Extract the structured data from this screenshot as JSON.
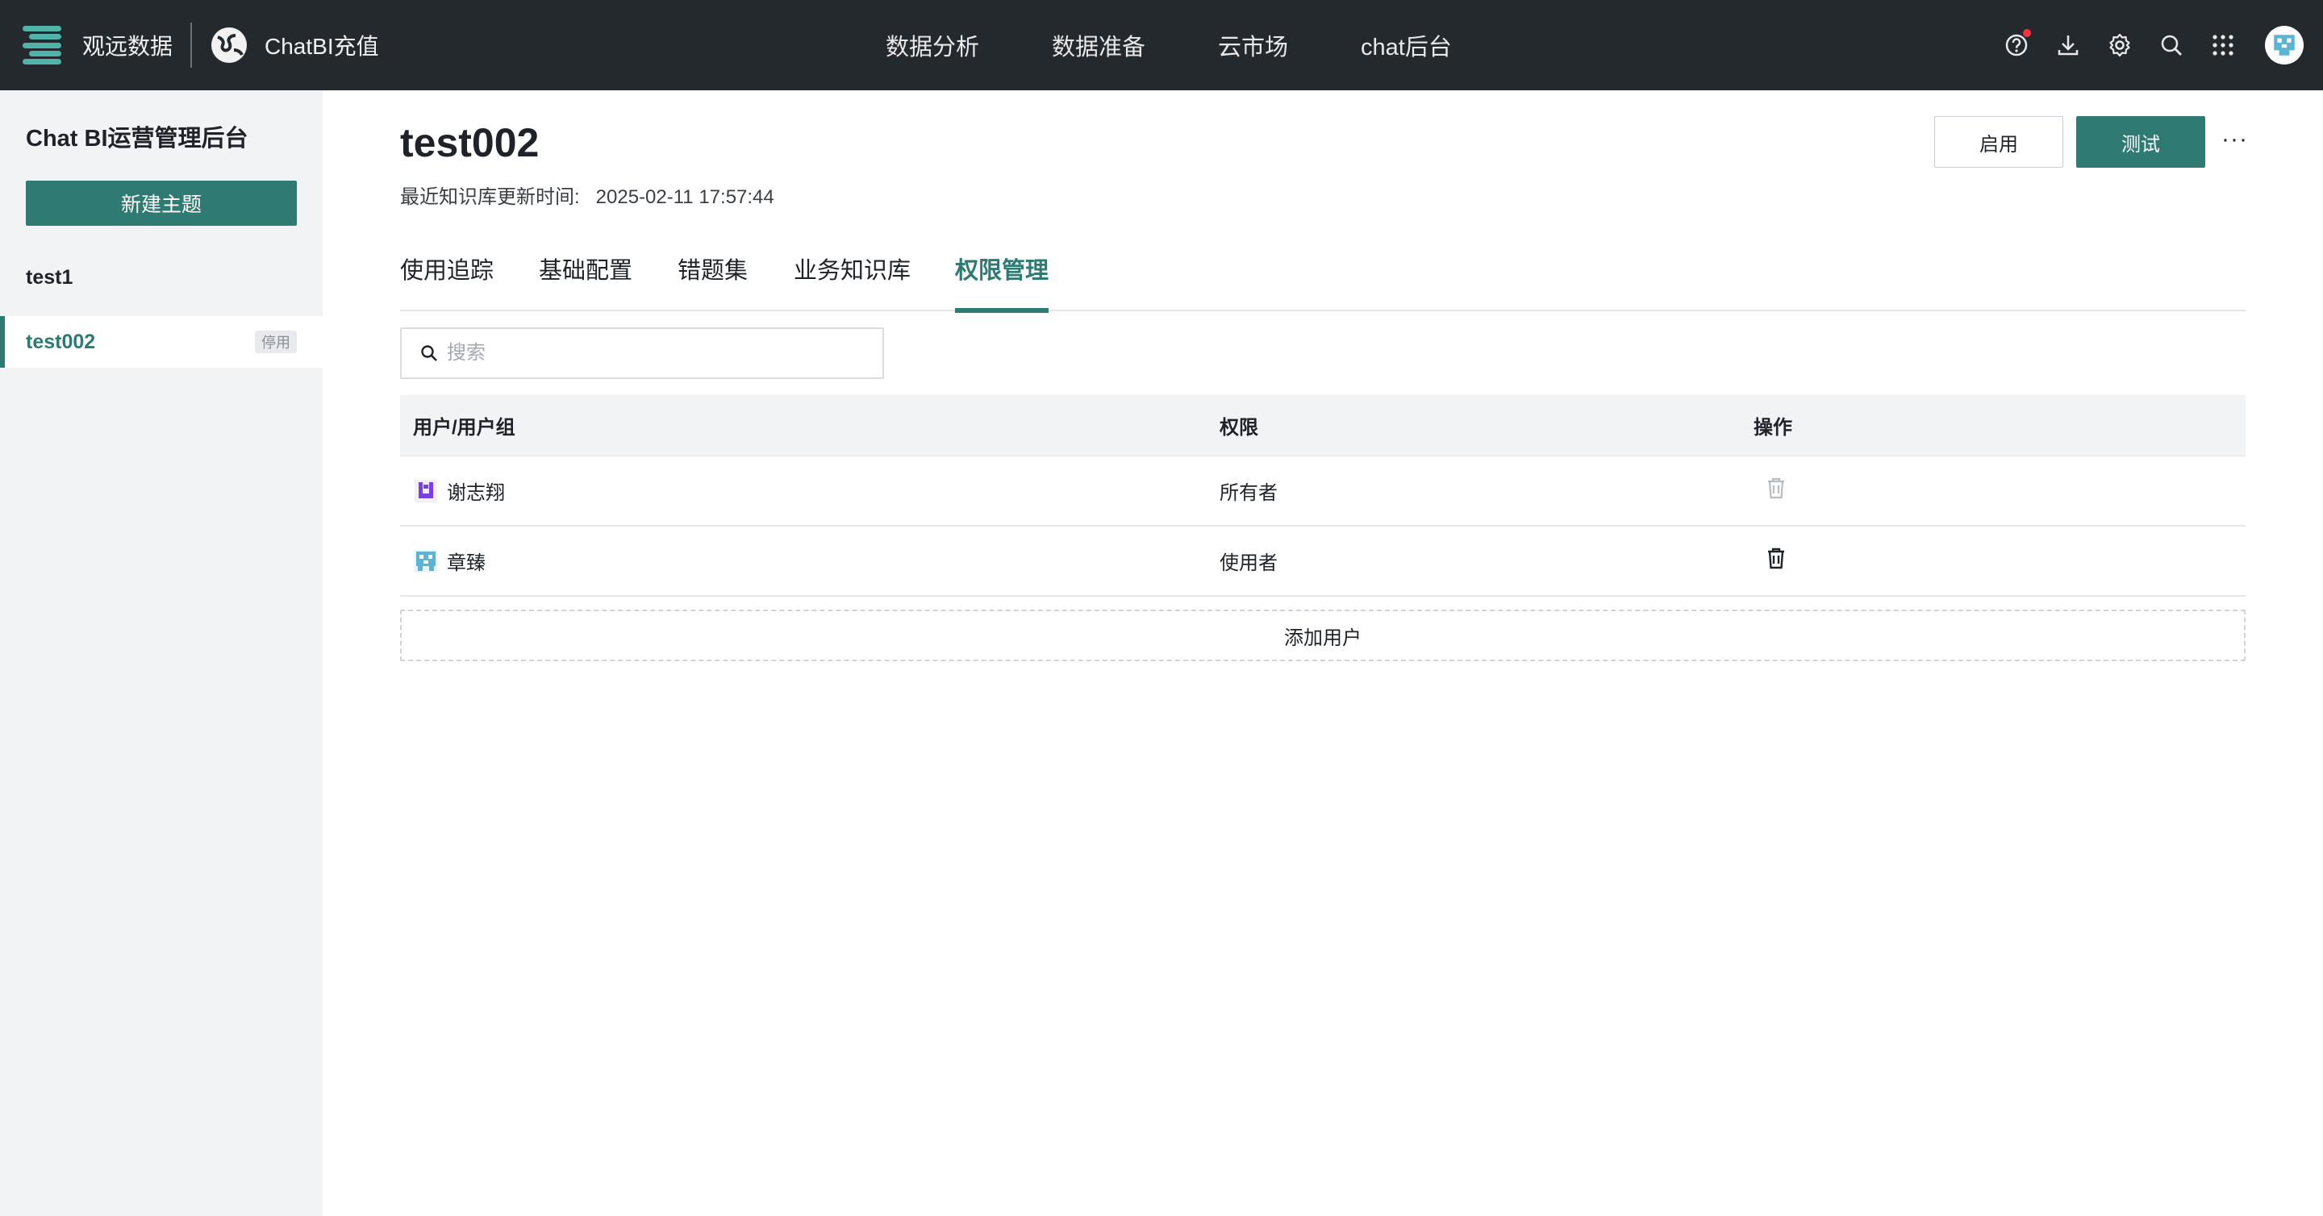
{
  "topbar": {
    "company": "观远数据",
    "app_name": "ChatBI充值",
    "nav": [
      "数据分析",
      "数据准备",
      "云市场",
      "chat后台"
    ],
    "icons": [
      "help-icon",
      "download-icon",
      "settings-icon",
      "search-icon",
      "apps-grid-icon",
      "avatar"
    ],
    "accent": "#4fb3a9",
    "background": "#24292e"
  },
  "sidebar": {
    "title": "Chat BI运营管理后台",
    "new_topic_label": "新建主题",
    "topics": [
      {
        "name": "test1",
        "badge": ""
      },
      {
        "name": "test002",
        "badge": "停用",
        "selected": true
      }
    ]
  },
  "main": {
    "title": "test002",
    "update_label": "最近知识库更新时间:",
    "update_time": "2025-02-11 17:57:44",
    "enable_label": "启用",
    "test_label": "测试",
    "more_label": "···",
    "tabs": [
      "使用追踪",
      "基础配置",
      "错题集",
      "业务知识库",
      "权限管理"
    ],
    "active_tab": "权限管理",
    "search_placeholder": "搜索",
    "table": {
      "headers": [
        "用户/用户组",
        "权限",
        "操作"
      ],
      "rows": [
        {
          "user": "谢志翔",
          "permission": "所有者",
          "avatar_color": "#7b3fe4",
          "delete_enabled": false
        },
        {
          "user": "章臻",
          "permission": "使用者",
          "avatar_color": "#5ab4d6",
          "delete_enabled": true
        }
      ]
    },
    "add_user_label": "添加用户"
  },
  "colors": {
    "primary": "#2f7a73",
    "notification": "#f5333f"
  }
}
